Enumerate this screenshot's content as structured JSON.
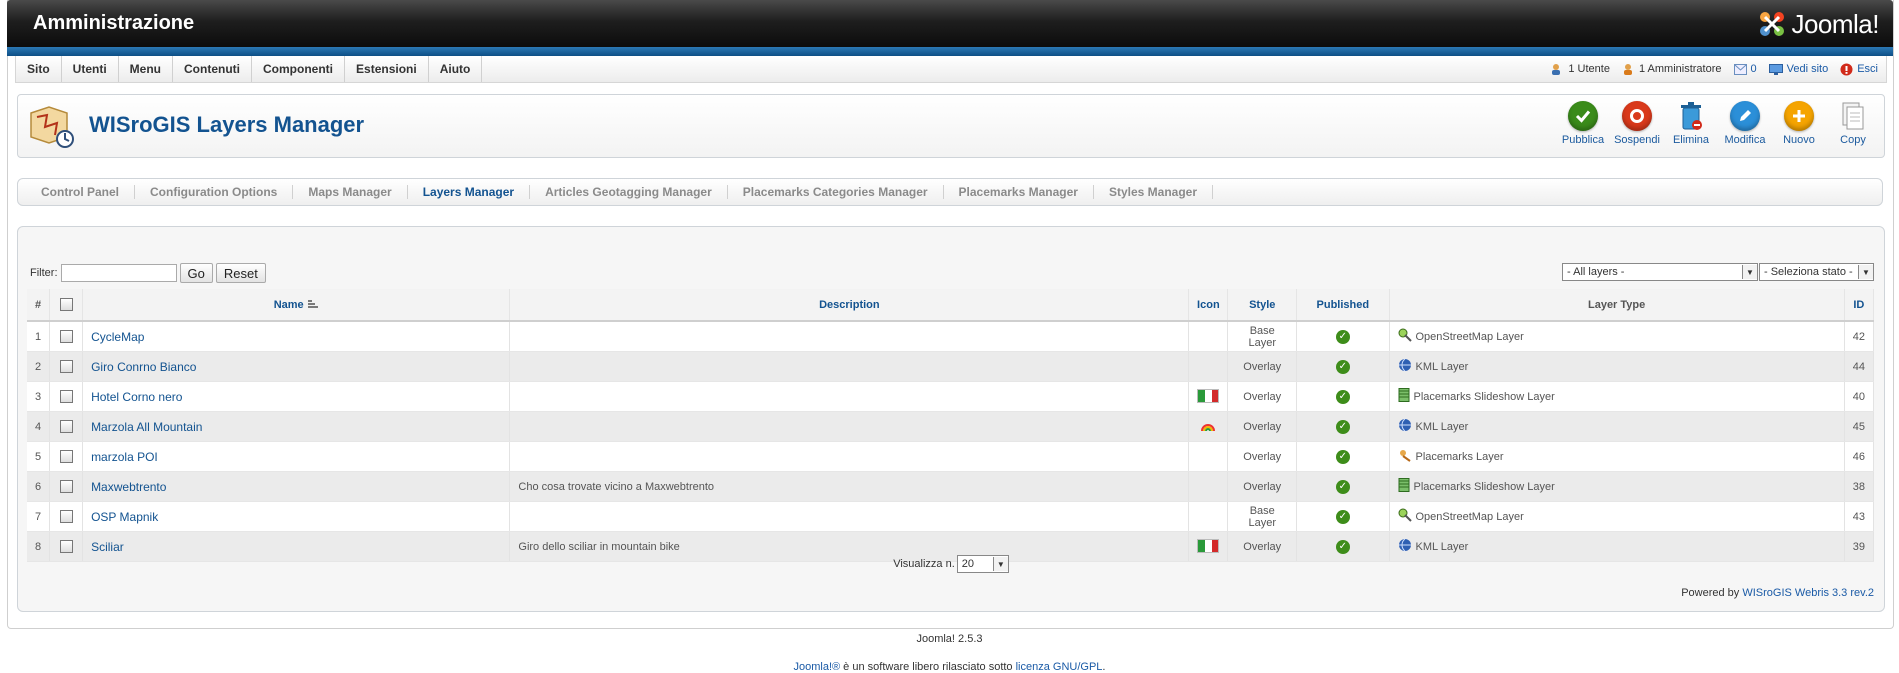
{
  "header": {
    "title": "Amministrazione",
    "logo_text": "Joomla!"
  },
  "menu": {
    "items": [
      "Sito",
      "Utenti",
      "Menu",
      "Contenuti",
      "Componenti",
      "Estensioni",
      "Aiuto"
    ]
  },
  "status": {
    "users": "1 Utente",
    "admins": "1 Amministratore",
    "messages": "0",
    "view_site": "Vedi sito",
    "logout": "Esci"
  },
  "page": {
    "title": "WISroGIS Layers Manager"
  },
  "toolbar": {
    "buttons": [
      {
        "label": "Pubblica",
        "color": "#3a8b1a",
        "icon": "check-icon"
      },
      {
        "label": "Sospendi",
        "color": "#d9391b",
        "icon": "unpublish-icon"
      },
      {
        "label": "Elimina",
        "color": "#3b9ad9",
        "icon": "trash-icon"
      },
      {
        "label": "Modifica",
        "color": "#2b8fd8",
        "icon": "pencil-icon"
      },
      {
        "label": "Nuovo",
        "color": "#f5a400",
        "icon": "plus-icon"
      },
      {
        "label": "Copy",
        "color": "#d8d8d8",
        "icon": "copy-icon"
      }
    ]
  },
  "submenu": {
    "items": [
      "Control Panel",
      "Configuration Options",
      "Maps Manager",
      "Layers Manager",
      "Articles Geotagging Manager",
      "Placemarks Categories Manager",
      "Placemarks Manager",
      "Styles Manager"
    ],
    "active": "Layers Manager"
  },
  "filter": {
    "label": "Filter:",
    "value": "",
    "go_label": "Go",
    "reset_label": "Reset",
    "layers_select": "- All layers -",
    "state_select": "- Seleziona stato -"
  },
  "table": {
    "headers": {
      "num": "#",
      "name": "Name",
      "description": "Description",
      "icon": "Icon",
      "style": "Style",
      "published": "Published",
      "layer_type": "Layer Type",
      "id": "ID"
    },
    "rows": [
      {
        "num": "1",
        "name": "CycleMap",
        "description": "",
        "icon": "",
        "style": "Base Layer",
        "layer_type": "OpenStreetMap Layer",
        "type_icon": "osm-icon",
        "id": "42"
      },
      {
        "num": "2",
        "name": "Giro Conrno Bianco",
        "description": "",
        "icon": "",
        "style": "Overlay",
        "layer_type": "KML Layer",
        "type_icon": "kml-icon",
        "id": "44"
      },
      {
        "num": "3",
        "name": "Hotel Corno nero",
        "description": "",
        "icon": "italy-flag-icon",
        "style": "Overlay",
        "layer_type": "Placemarks Slideshow Layer",
        "type_icon": "slideshow-icon",
        "id": "40"
      },
      {
        "num": "4",
        "name": "Marzola All Mountain",
        "description": "",
        "icon": "rainbow-icon",
        "style": "Overlay",
        "layer_type": "KML Layer",
        "type_icon": "kml-icon",
        "id": "45"
      },
      {
        "num": "5",
        "name": "marzola POI",
        "description": "",
        "icon": "",
        "style": "Overlay",
        "layer_type": "Placemarks Layer",
        "type_icon": "placemark-icon",
        "id": "46"
      },
      {
        "num": "6",
        "name": "Maxwebtrento",
        "description": "Cho cosa trovate vicino a Maxwebtrento",
        "icon": "",
        "style": "Overlay",
        "layer_type": "Placemarks Slideshow Layer",
        "type_icon": "slideshow-icon",
        "id": "38"
      },
      {
        "num": "7",
        "name": "OSP Mapnik",
        "description": "",
        "icon": "",
        "style": "Base Layer",
        "layer_type": "OpenStreetMap Layer",
        "type_icon": "osm-icon",
        "id": "43"
      },
      {
        "num": "8",
        "name": "Sciliar",
        "description": "Giro dello sciliar in mountain bike",
        "icon": "italy-flag-icon",
        "style": "Overlay",
        "layer_type": "KML Layer",
        "type_icon": "kml-icon",
        "id": "39"
      }
    ]
  },
  "pagination": {
    "label": "Visualizza n.",
    "value": "20"
  },
  "powered": {
    "prefix": "Powered by",
    "link": "WISroGIS Webris 3.3 rev.2"
  },
  "footer": {
    "version": "Joomla! 2.5.3",
    "joomla_link": "Joomla!®",
    "middle": " è un software libero rilasciato sotto ",
    "license_link": "licenza GNU/GPL",
    "end": "."
  }
}
